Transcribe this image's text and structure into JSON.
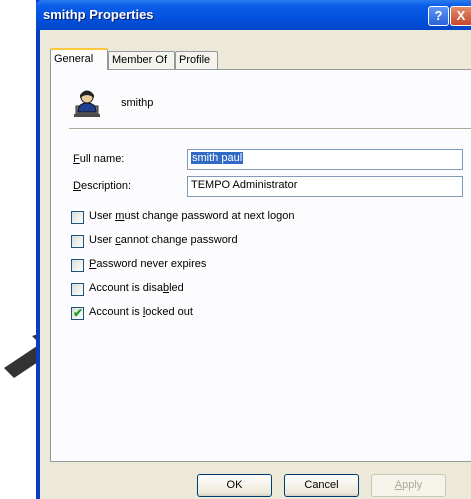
{
  "window": {
    "title": "smithp Properties",
    "help_glyph": "?",
    "close_glyph": "X"
  },
  "tabs": [
    {
      "label": "General",
      "active": true
    },
    {
      "label": "Member Of",
      "active": false
    },
    {
      "label": "Profile",
      "active": false
    }
  ],
  "user": {
    "name": "smithp",
    "icon": "user-icon"
  },
  "fields": {
    "full_name": {
      "label_prefix": "",
      "label_mnemonic": "F",
      "label_rest": "ull name:",
      "value": "smith paul"
    },
    "description": {
      "label_prefix": "",
      "label_mnemonic": "D",
      "label_rest": "escription:",
      "value": "TEMPO Administrator"
    }
  },
  "checkboxes": [
    {
      "pre": "User ",
      "mn": "m",
      "post": "ust change password at next logon",
      "checked": false
    },
    {
      "pre": "User ",
      "mn": "c",
      "post": "annot change password",
      "checked": false
    },
    {
      "pre": "",
      "mn": "P",
      "post": "assword never expires",
      "checked": false
    },
    {
      "pre": "Account is disa",
      "mn": "b",
      "post": "led",
      "checked": false
    },
    {
      "pre": "Account is ",
      "mn": "l",
      "post": "ocked out",
      "checked": true
    }
  ],
  "buttons": {
    "ok": "OK",
    "cancel": "Cancel",
    "apply_mnemonic": "A",
    "apply_rest": "pply"
  },
  "colors": {
    "titlebar": "#0352dd",
    "dialog_bg": "#ece9d8",
    "selection": "#316ac5",
    "check": "#21a121"
  }
}
